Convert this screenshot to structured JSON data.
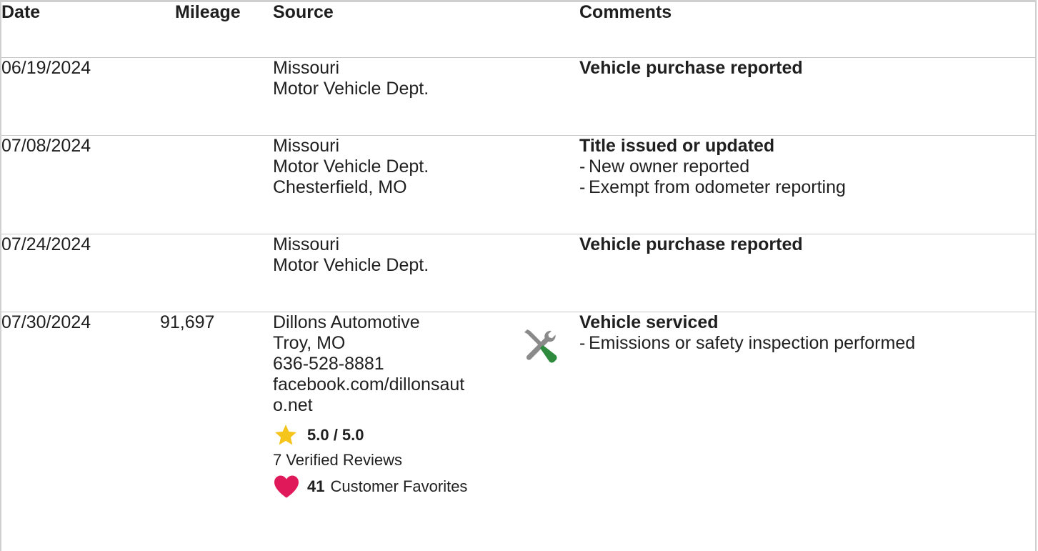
{
  "headers": {
    "date": "Date",
    "mileage": "Mileage",
    "source": "Source",
    "comments": "Comments"
  },
  "rows": [
    {
      "date": "06/19/2024",
      "mileage": "",
      "source": [
        "Missouri",
        "Motor Vehicle Dept."
      ],
      "comment_title": "Vehicle purchase reported",
      "comment_bullets": []
    },
    {
      "date": "07/08/2024",
      "mileage": "",
      "source": [
        "Missouri",
        "Motor Vehicle Dept.",
        "Chesterfield, MO"
      ],
      "comment_title": "Title issued or updated",
      "comment_bullets": [
        "New owner reported",
        "Exempt from odometer reporting"
      ]
    },
    {
      "date": "07/24/2024",
      "mileage": "",
      "source": [
        "Missouri",
        "Motor Vehicle Dept."
      ],
      "comment_title": "Vehicle purchase reported",
      "comment_bullets": []
    },
    {
      "date": "07/30/2024",
      "mileage": "91,697",
      "source": [
        "Dillons Automotive",
        "Troy, MO",
        "636-528-8881",
        "facebook.com/dillonsaut",
        "o.net"
      ],
      "rating": "5.0 / 5.0",
      "reviews": "7 Verified Reviews",
      "favorites_count": "41",
      "favorites_label": "Customer Favorites",
      "icon": "wrench-screwdriver-icon",
      "comment_title": "Vehicle serviced",
      "comment_bullets": [
        "Emissions or safety inspection performed"
      ]
    }
  ],
  "bullet_dash": "-",
  "colors": {
    "star": "#f5c51c",
    "heart": "#e0195a",
    "screwdriver": "#2e8b3e",
    "wrench": "#8a8a8a",
    "divider": "#c8c8c8"
  }
}
